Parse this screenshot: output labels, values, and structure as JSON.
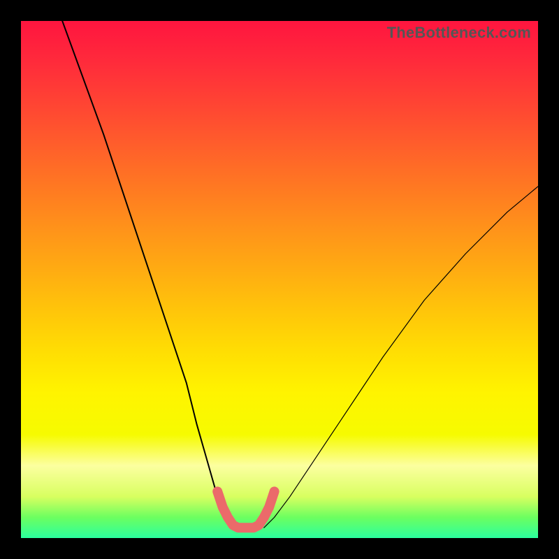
{
  "watermark": "TheBottleneck.com",
  "chart_data": {
    "type": "line",
    "title": "",
    "xlabel": "",
    "ylabel": "",
    "ylim": [
      0,
      100
    ],
    "xlim": [
      0,
      100
    ],
    "series": [
      {
        "name": "left-curve",
        "x": [
          8,
          12,
          16,
          20,
          24,
          28,
          32,
          34,
          36,
          38,
          39.5,
          40.5
        ],
        "y": [
          100,
          89,
          78,
          66,
          54,
          42,
          30,
          22,
          15,
          8,
          4,
          2
        ]
      },
      {
        "name": "right-curve",
        "x": [
          47,
          49,
          52,
          56,
          62,
          70,
          78,
          86,
          94,
          100
        ],
        "y": [
          2,
          4,
          8,
          14,
          23,
          35,
          46,
          55,
          63,
          68
        ]
      },
      {
        "name": "u-highlight",
        "x": [
          38,
          39,
          40,
          41,
          42,
          43,
          44,
          45,
          46,
          47,
          48,
          49
        ],
        "y": [
          9,
          6,
          4,
          2.5,
          2,
          2,
          2,
          2,
          2.5,
          4,
          6,
          9
        ]
      }
    ],
    "background_gradient": {
      "top": "#ff153f",
      "bottom": "#2bff9e"
    }
  }
}
